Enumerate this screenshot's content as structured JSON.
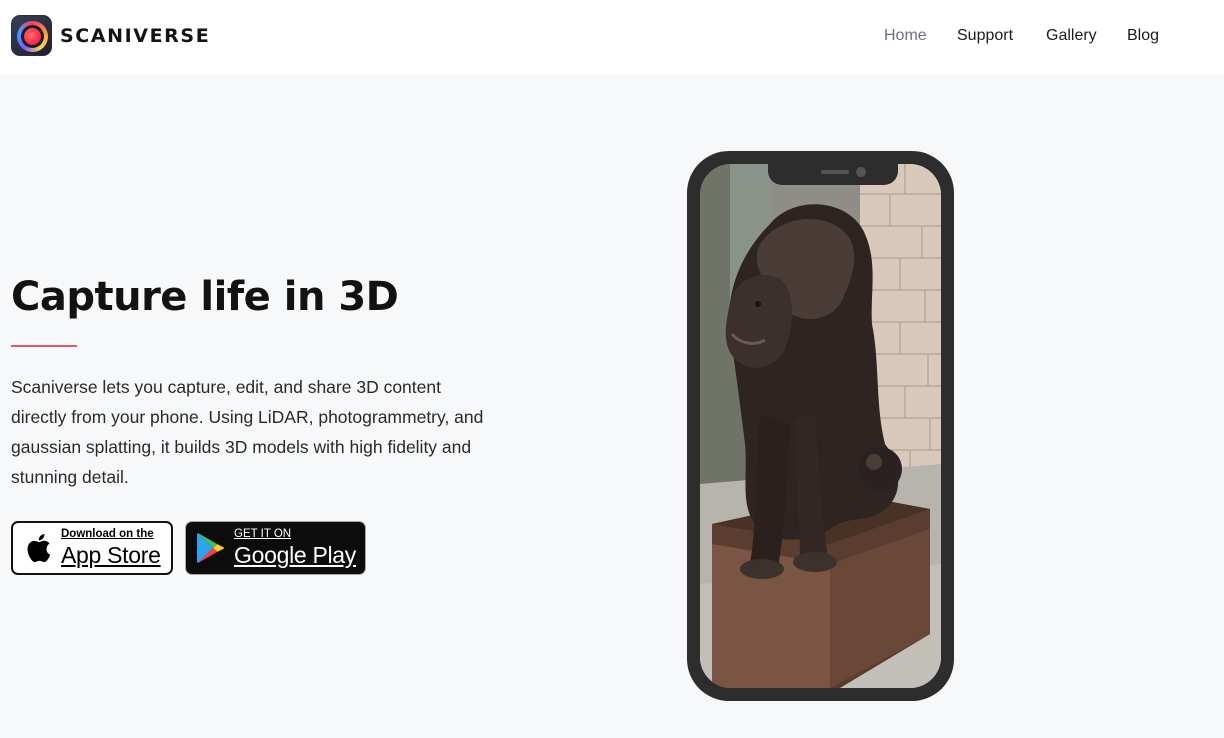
{
  "brand": {
    "name": "SCANIVERSE",
    "logo_icon": "scaniverse-lens-icon"
  },
  "nav": {
    "items": [
      {
        "label": "Home",
        "active": true
      },
      {
        "label": "Support",
        "active": false
      },
      {
        "label": "Gallery",
        "active": false
      },
      {
        "label": "Blog",
        "active": false
      }
    ]
  },
  "hero": {
    "title": "Capture life in 3D",
    "description": "Scaniverse lets you capture, edit, and share 3D content directly from your phone. Using LiDAR, photogrammetry, and gaussian splatting, it builds 3D models with high fidelity and stunning detail."
  },
  "store_buttons": {
    "appstore": {
      "small": "Download on the",
      "big": "App Store",
      "icon": "apple-icon"
    },
    "playstore": {
      "small": "GET IT ON",
      "big": "Google Play",
      "icon": "google-play-icon"
    }
  },
  "colors": {
    "accent": "#e8556a",
    "nav_active": "#6b7280",
    "page_bg": "#f7f8fa",
    "phone_frame": "#2d2d2d"
  }
}
